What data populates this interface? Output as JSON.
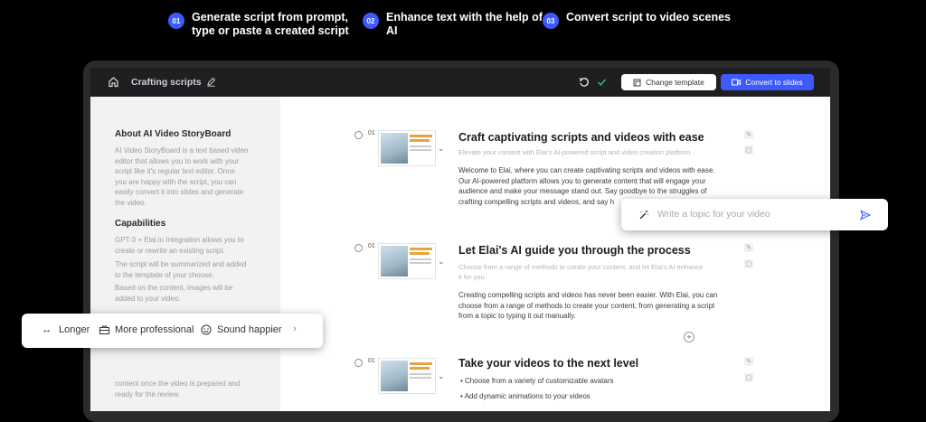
{
  "steps": [
    {
      "num": "01",
      "line1": "Generate script from prompt,",
      "line2": "type or paste a created script"
    },
    {
      "num": "02",
      "line1": "Enhance text with the help of",
      "line2": "AI"
    },
    {
      "num": "03",
      "line1": "Convert script to video scenes",
      "line2": ""
    }
  ],
  "topbar": {
    "title": "Crafting scripts",
    "change_template": "Change template",
    "convert": "Convert to slides"
  },
  "sidebar": {
    "about_heading": "About AI Video StoryBoard",
    "about_lines": [
      "AI Video StoryBoard is a text based video",
      "editor that allows you to work with your",
      "script like it's regular text editor. Once",
      "you are happy with the script, you can",
      "easily convert it into slides and generate",
      "the video."
    ],
    "cap_heading": "Capabilities",
    "cap1": [
      "GPT-3 + Elai.io Integration allows you to",
      "create or rewrite an existing script."
    ],
    "cap2": [
      "The script will be summarized and added",
      "to the template of your choose."
    ],
    "cap3": [
      "Based on the content, images will be",
      "added to your video."
    ],
    "cap4": [
      "content once the video is prepared and",
      "ready for the review."
    ]
  },
  "scenes": [
    {
      "num": "01",
      "title": "Craft captivating scripts and videos with ease",
      "subtitle": [
        "Elevate your content with Elai's AI-powered script and video creation platform"
      ],
      "body": [
        "Welcome to Elai, where you can create captivating scripts and videos with ease.",
        "Our AI-powered platform allows you to generate content that will engage your",
        "audience and make your message stand out. Say goodbye to the struggles of",
        "crafting compelling scripts and videos, and say h"
      ]
    },
    {
      "num": "01",
      "title": "Let Elai's AI guide you through the process",
      "subtitle": [
        "Choose from a range of methods to create your content, and let Elai's AI enhance",
        "it for you"
      ],
      "body": [
        "Creating compelling scripts and videos has never been easier. With Elai, you can",
        "choose from a range of methods to create your content, from generating a script",
        "from a topic to typing it out manually."
      ]
    },
    {
      "num": "01",
      "title": "Take your videos to the next level",
      "bullets": [
        "Choose from a variety of customizable avatars",
        "Add dynamic animations to your videos"
      ]
    }
  ],
  "topic_popup": {
    "placeholder": "Write a topic for your video"
  },
  "tone_popup": {
    "longer": "Longer",
    "professional": "More professional",
    "happier": "Sound happier"
  },
  "colors": {
    "accent": "#3d5afe",
    "background": "#000000"
  }
}
